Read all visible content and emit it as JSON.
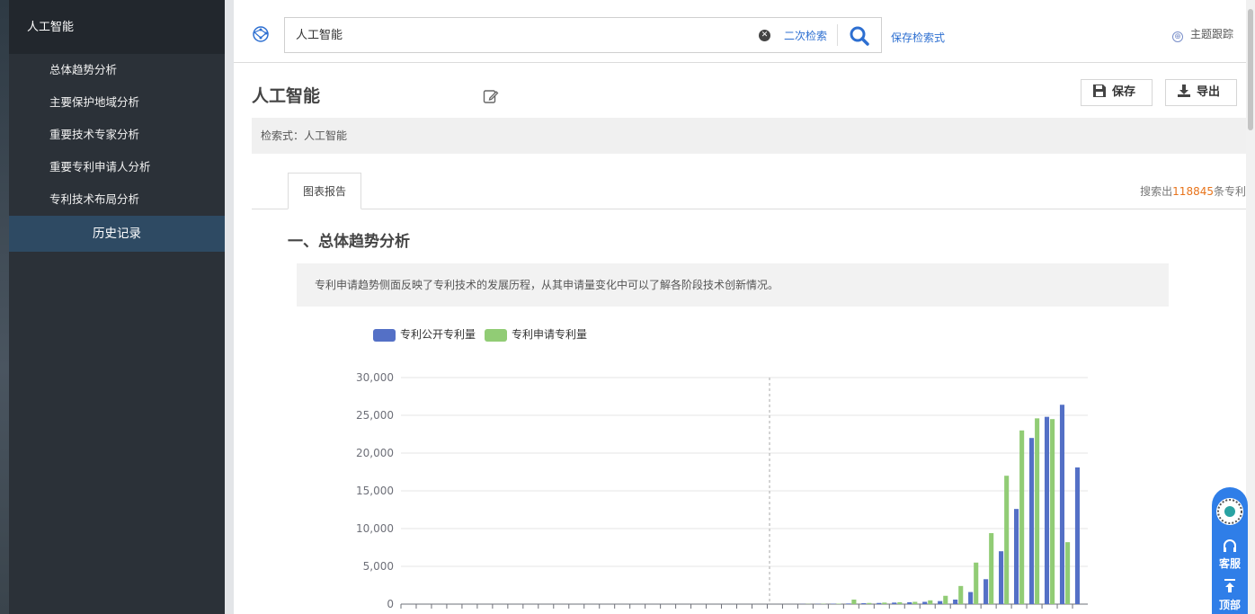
{
  "sidebar": {
    "title": "人工智能",
    "items": [
      {
        "label": "总体趋势分析"
      },
      {
        "label": "主要保护地域分析"
      },
      {
        "label": "重要技术专家分析"
      },
      {
        "label": "重要专利申请人分析"
      },
      {
        "label": "专利技术布局分析"
      }
    ],
    "history": "历史记录"
  },
  "topbar": {
    "search_value": "人工智能",
    "secondary_search": "二次检索",
    "save_query": "保存检索式",
    "topic_track": "主题跟踪"
  },
  "header": {
    "title": "人工智能",
    "save_label": "保存",
    "export_label": "导出"
  },
  "query": {
    "label": "检索式：",
    "value": "人工智能"
  },
  "tabs": [
    {
      "label": "图表报告"
    }
  ],
  "results": {
    "prefix": "搜索出",
    "count": "118845",
    "suffix": "条专利"
  },
  "section": {
    "title": "一、总体趋势分析",
    "description": "专利申请趋势侧面反映了专利技术的发展历程，从其申请量变化中可以了解各阶段技术创新情况。"
  },
  "floating": {
    "service": "客服",
    "top": "顶部"
  },
  "colors": {
    "publish": "#5470c6",
    "apply": "#91cc75",
    "accent": "#2f7ee8",
    "count": "#e8731a"
  },
  "chart_data": {
    "type": "bar",
    "legend_position": "top-left",
    "grid": true,
    "y_ticks": [
      "30,000",
      "25,000",
      "20,000",
      "15,000",
      "10,000",
      "5,000",
      "0"
    ],
    "ylim": [
      0,
      30000
    ],
    "series": [
      {
        "name": "专利公开专利量",
        "values": [
          0,
          0,
          0,
          0,
          0,
          0,
          0,
          0,
          0,
          0,
          0,
          0,
          0,
          0,
          0,
          0,
          0,
          0,
          0,
          0,
          0,
          0,
          0,
          0,
          0,
          0,
          20,
          30,
          50,
          80,
          120,
          150,
          200,
          250,
          300,
          400,
          600,
          1600,
          3300,
          7000,
          12600,
          22000,
          24800,
          26400,
          18100
        ]
      },
      {
        "name": "专利申请专利量",
        "values": [
          0,
          0,
          0,
          0,
          0,
          0,
          0,
          0,
          0,
          0,
          0,
          0,
          0,
          0,
          0,
          0,
          0,
          0,
          0,
          0,
          0,
          0,
          0,
          0,
          0,
          0,
          30,
          40,
          60,
          600,
          150,
          200,
          250,
          300,
          500,
          1100,
          2400,
          5500,
          9400,
          17000,
          23000,
          24600,
          24500,
          8200,
          0
        ]
      }
    ]
  }
}
